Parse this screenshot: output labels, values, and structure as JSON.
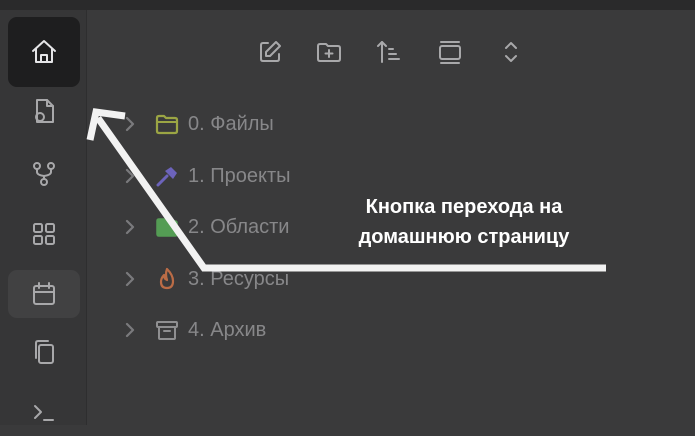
{
  "ribbon": {
    "items": [
      {
        "icon": "home-icon",
        "state": "active"
      },
      {
        "icon": "new-file-icon",
        "state": "normal"
      },
      {
        "icon": "graph-icon",
        "state": "normal"
      },
      {
        "icon": "blocks-icon",
        "state": "normal"
      },
      {
        "icon": "calendar-icon",
        "state": "hover"
      },
      {
        "icon": "copy-icon",
        "state": "normal"
      },
      {
        "icon": "terminal-icon",
        "state": "normal"
      }
    ]
  },
  "toolbar": {
    "items": [
      {
        "icon": "edit-note-icon"
      },
      {
        "icon": "new-folder-icon"
      },
      {
        "icon": "sort-icon"
      },
      {
        "icon": "collapse-all-icon"
      },
      {
        "icon": "expand-icon"
      }
    ]
  },
  "tree": {
    "items": [
      {
        "label": "0. Файлы",
        "icon": "folder-icon",
        "color": "#b7c447"
      },
      {
        "label": "1. Проекты",
        "icon": "hammer-icon",
        "color": "#7b6fe0"
      },
      {
        "label": "2. Области",
        "icon": "folder-check-icon",
        "color": "#5cb85c"
      },
      {
        "label": "3. Ресурсы",
        "icon": "flame-icon",
        "color": "#e07a4a"
      },
      {
        "label": "4. Архив",
        "icon": "archive-icon",
        "color": "#a8a8aa"
      }
    ]
  },
  "annotation": {
    "line1": "Кнопка перехода на",
    "line2": "домашнюю страницу"
  }
}
